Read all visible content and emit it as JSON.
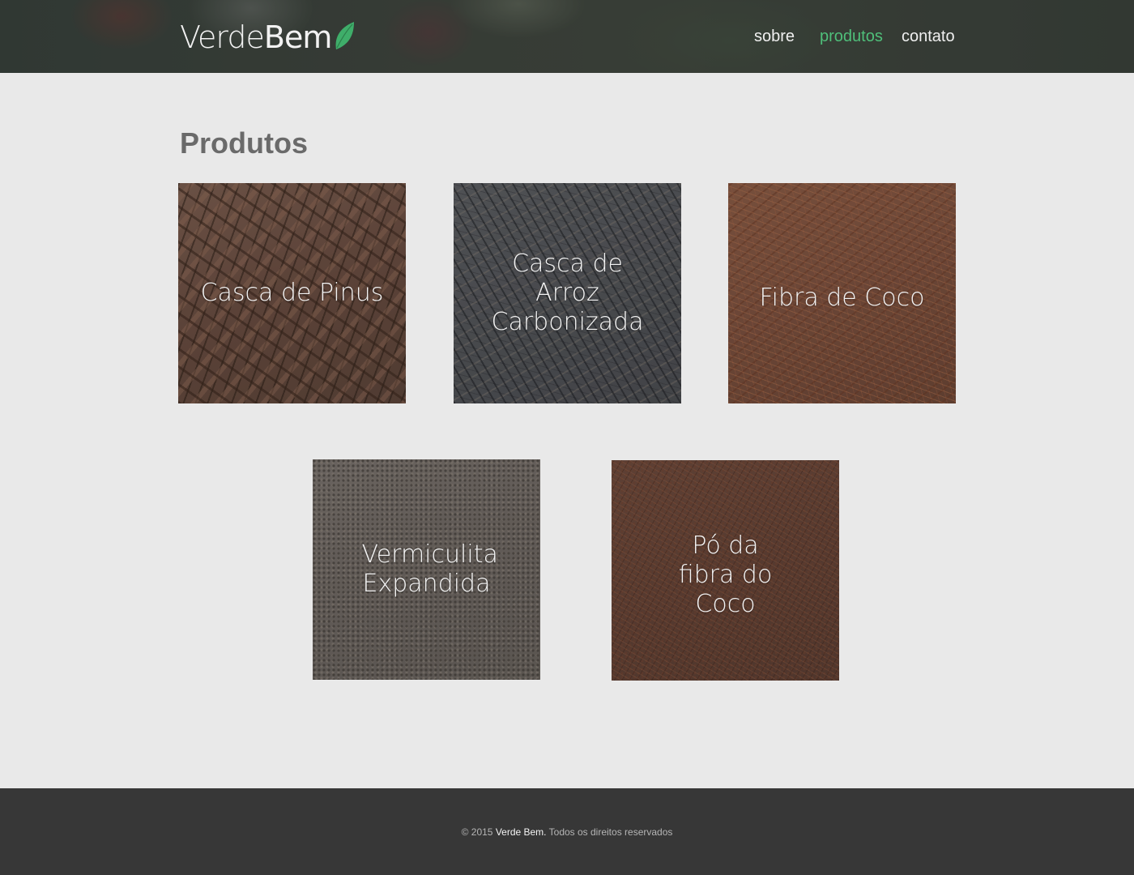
{
  "brand": {
    "word1": "Verde",
    "word2": "Bem",
    "icon": "leaf-icon",
    "accent": "#4fbf7a"
  },
  "nav": {
    "sobre": "sobre",
    "produtos": "produtos",
    "contato": "contato",
    "active": "produtos"
  },
  "page_title": "Produtos",
  "products": [
    {
      "label": "Casca de Pinus"
    },
    {
      "label": "Casca de Arroz Carbonizada"
    },
    {
      "label": "Fibra de Coco"
    },
    {
      "label": "Vermiculita Expandida"
    },
    {
      "label": "Pó da fibra do Coco"
    }
  ],
  "footer": {
    "copyright": "© 2015",
    "brand": "Verde Bem.",
    "rights": "Todos os direitos reservados"
  }
}
